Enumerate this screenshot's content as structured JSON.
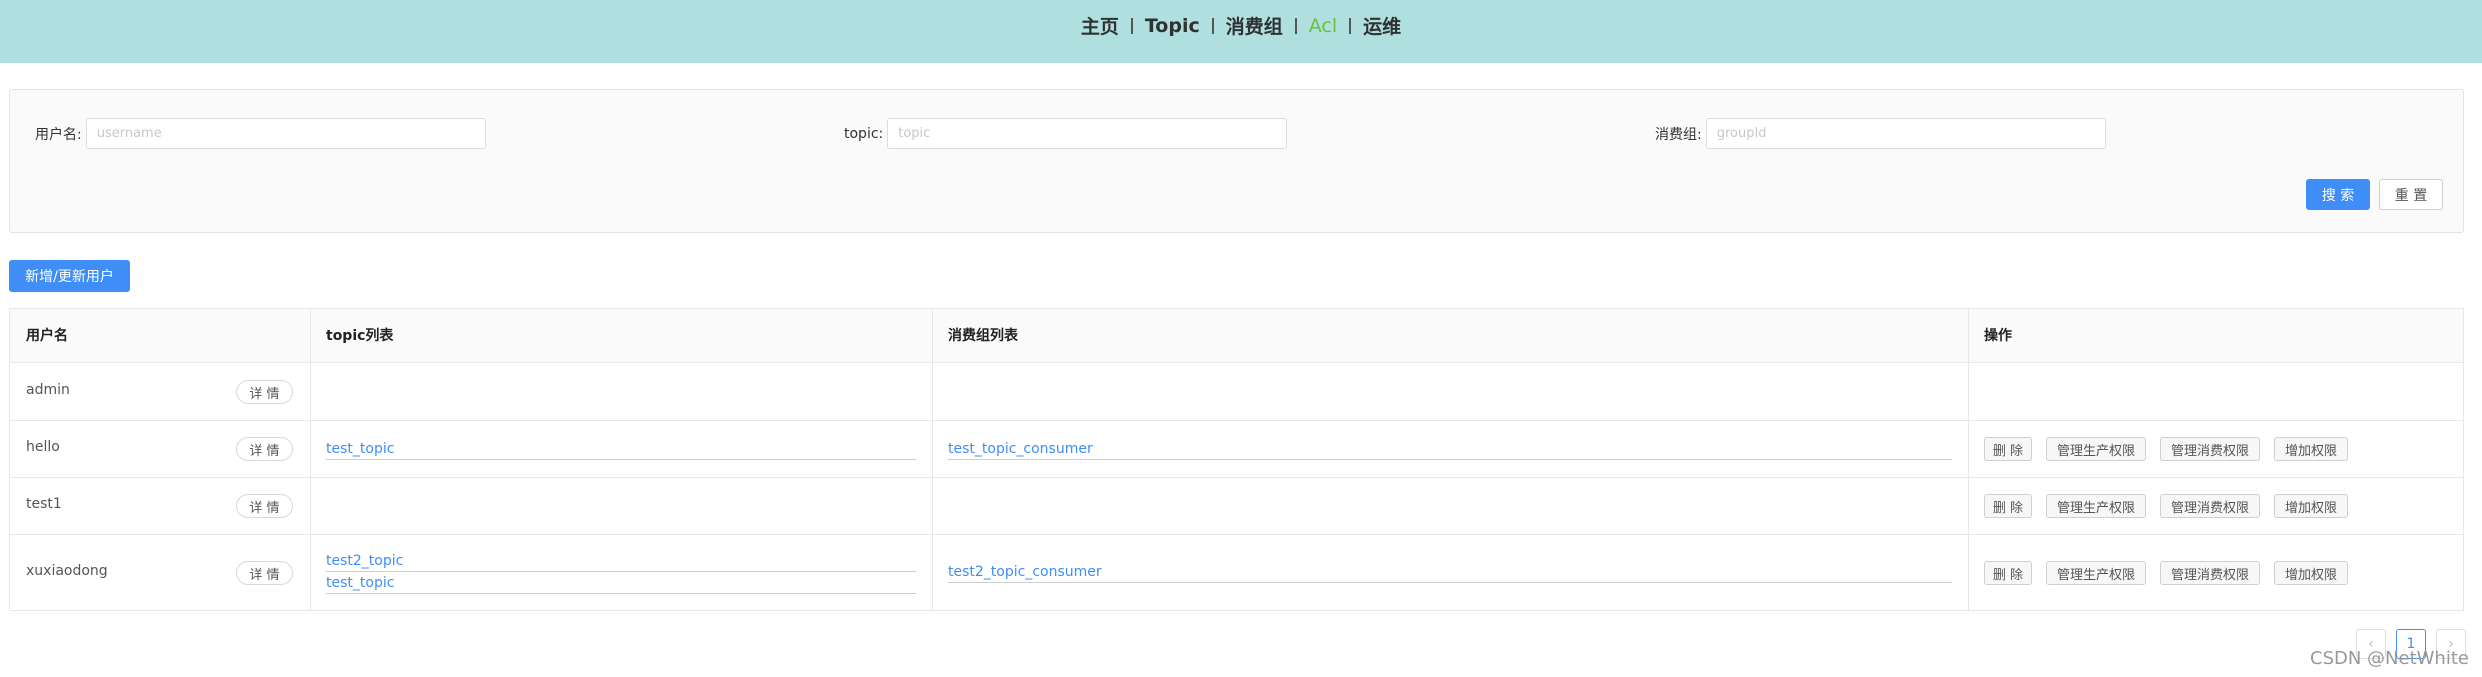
{
  "nav": {
    "items": [
      {
        "label": "主页"
      },
      {
        "label": "Topic"
      },
      {
        "label": "消费组"
      },
      {
        "label": "Acl"
      },
      {
        "label": "运维"
      }
    ]
  },
  "search": {
    "username_label": "用户名:",
    "username_placeholder": "username",
    "topic_label": "topic:",
    "topic_placeholder": "topic",
    "group_label": "消费组:",
    "group_placeholder": "groupId",
    "search_button": "搜 索",
    "reset_button": "重 置"
  },
  "add_button": "新增/更新用户",
  "table": {
    "headers": [
      "用户名",
      "topic列表",
      "消费组列表",
      "操作"
    ],
    "detail_label": "详 情",
    "actions": [
      "删 除",
      "管理生产权限",
      "管理消费权限",
      "增加权限"
    ],
    "rows": [
      {
        "username": "admin",
        "topics": [],
        "groups": []
      },
      {
        "username": "hello",
        "topics": [
          "test_topic"
        ],
        "groups": [
          "test_topic_consumer"
        ]
      },
      {
        "username": "test1",
        "topics": [],
        "groups": []
      },
      {
        "username": "xuxiaodong",
        "topics": [
          "test2_topic",
          "test_topic"
        ],
        "groups": [
          "test2_topic_consumer"
        ]
      }
    ]
  },
  "pagination": {
    "prev": "‹",
    "current": "1",
    "next": "›"
  },
  "watermark": "CSDN @NetWhite",
  "colors": {
    "nav_bg": "#b0dfdf",
    "active": "#67c23a",
    "primary": "#3f8ef7",
    "link": "#3f8ef7"
  }
}
